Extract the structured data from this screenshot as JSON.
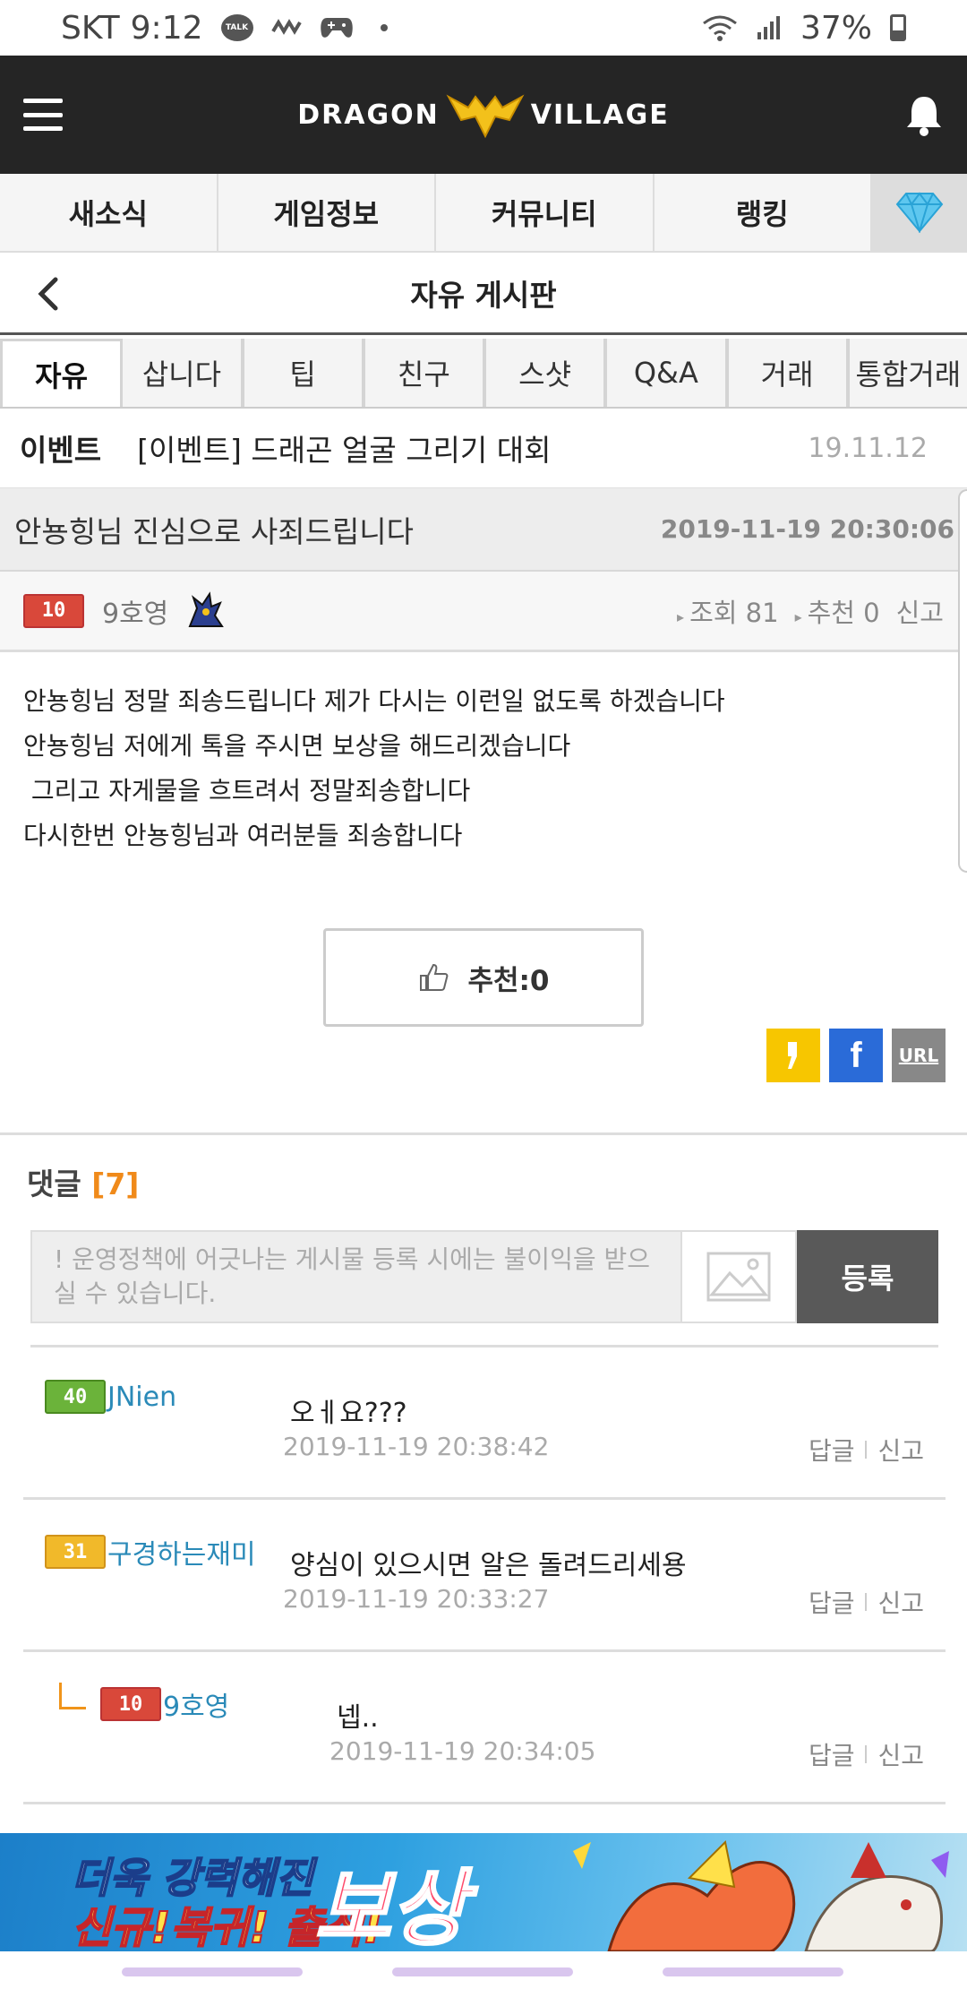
{
  "status_bar": {
    "carrier": "SKT",
    "time": "9:12",
    "talk_label": "TALK",
    "battery": "37%"
  },
  "header": {
    "logo_left": "DRAGON",
    "logo_right": "VILLAGE"
  },
  "main_nav": [
    "새소식",
    "게임정보",
    "커뮤니티",
    "랭킹"
  ],
  "board": {
    "title": "자유 게시판"
  },
  "sub_tabs": [
    "자유",
    "삽니다",
    "팁",
    "친구",
    "스샷",
    "Q&A",
    "거래",
    "통합거래"
  ],
  "event": {
    "label": "이벤트",
    "title": "[이벤트] 드래곤 얼굴 그리기 대회",
    "date": "19.11.12"
  },
  "post": {
    "title": "안뇽힝님 진심으로 사죄드립니다",
    "date": "2019-11-19 20:30:06",
    "author": {
      "level": "10",
      "name": "9호영"
    },
    "views": "조회 81",
    "recommends": "추천 0",
    "report": "신고",
    "body": [
      "안뇽힝님 정말 죄송드립니다 제가 다시는 이런일 없도록 하겠습니다",
      "안뇽힝님 저에게 톡을 주시면 보상을 해드리겠습니다",
      " 그리고 자게물을 흐트려서 정말죄송합니다",
      "다시한번 안뇽힝님과 여러분들 죄송합니다"
    ],
    "recommend_button": "추천:0"
  },
  "share": {
    "url_label": "URL"
  },
  "comments": {
    "heading": "댓글",
    "count": "[7]",
    "input_placeholder": "! 운영정책에 어긋나는 게시물 등록 시에는 불이익을 받으실 수 있습니다.",
    "submit_label": "등록",
    "reply_label": "답글",
    "report_label": "신고",
    "items": [
      {
        "level": "40",
        "name": "JNien",
        "text": "오ㅔ요???",
        "date": "2019-11-19 20:38:42"
      },
      {
        "level": "31",
        "name": "구경하는재미",
        "text": "양심이 있으시면 알은 돌려드리세용",
        "date": "2019-11-19 20:33:27"
      },
      {
        "level": "10",
        "name": "9호영",
        "text": "넵..",
        "date": "2019-11-19 20:34:05"
      }
    ]
  },
  "banner": {
    "line1": "더욱 강력해진",
    "line2": "신규!복귀! 출석!",
    "big": "보상"
  }
}
